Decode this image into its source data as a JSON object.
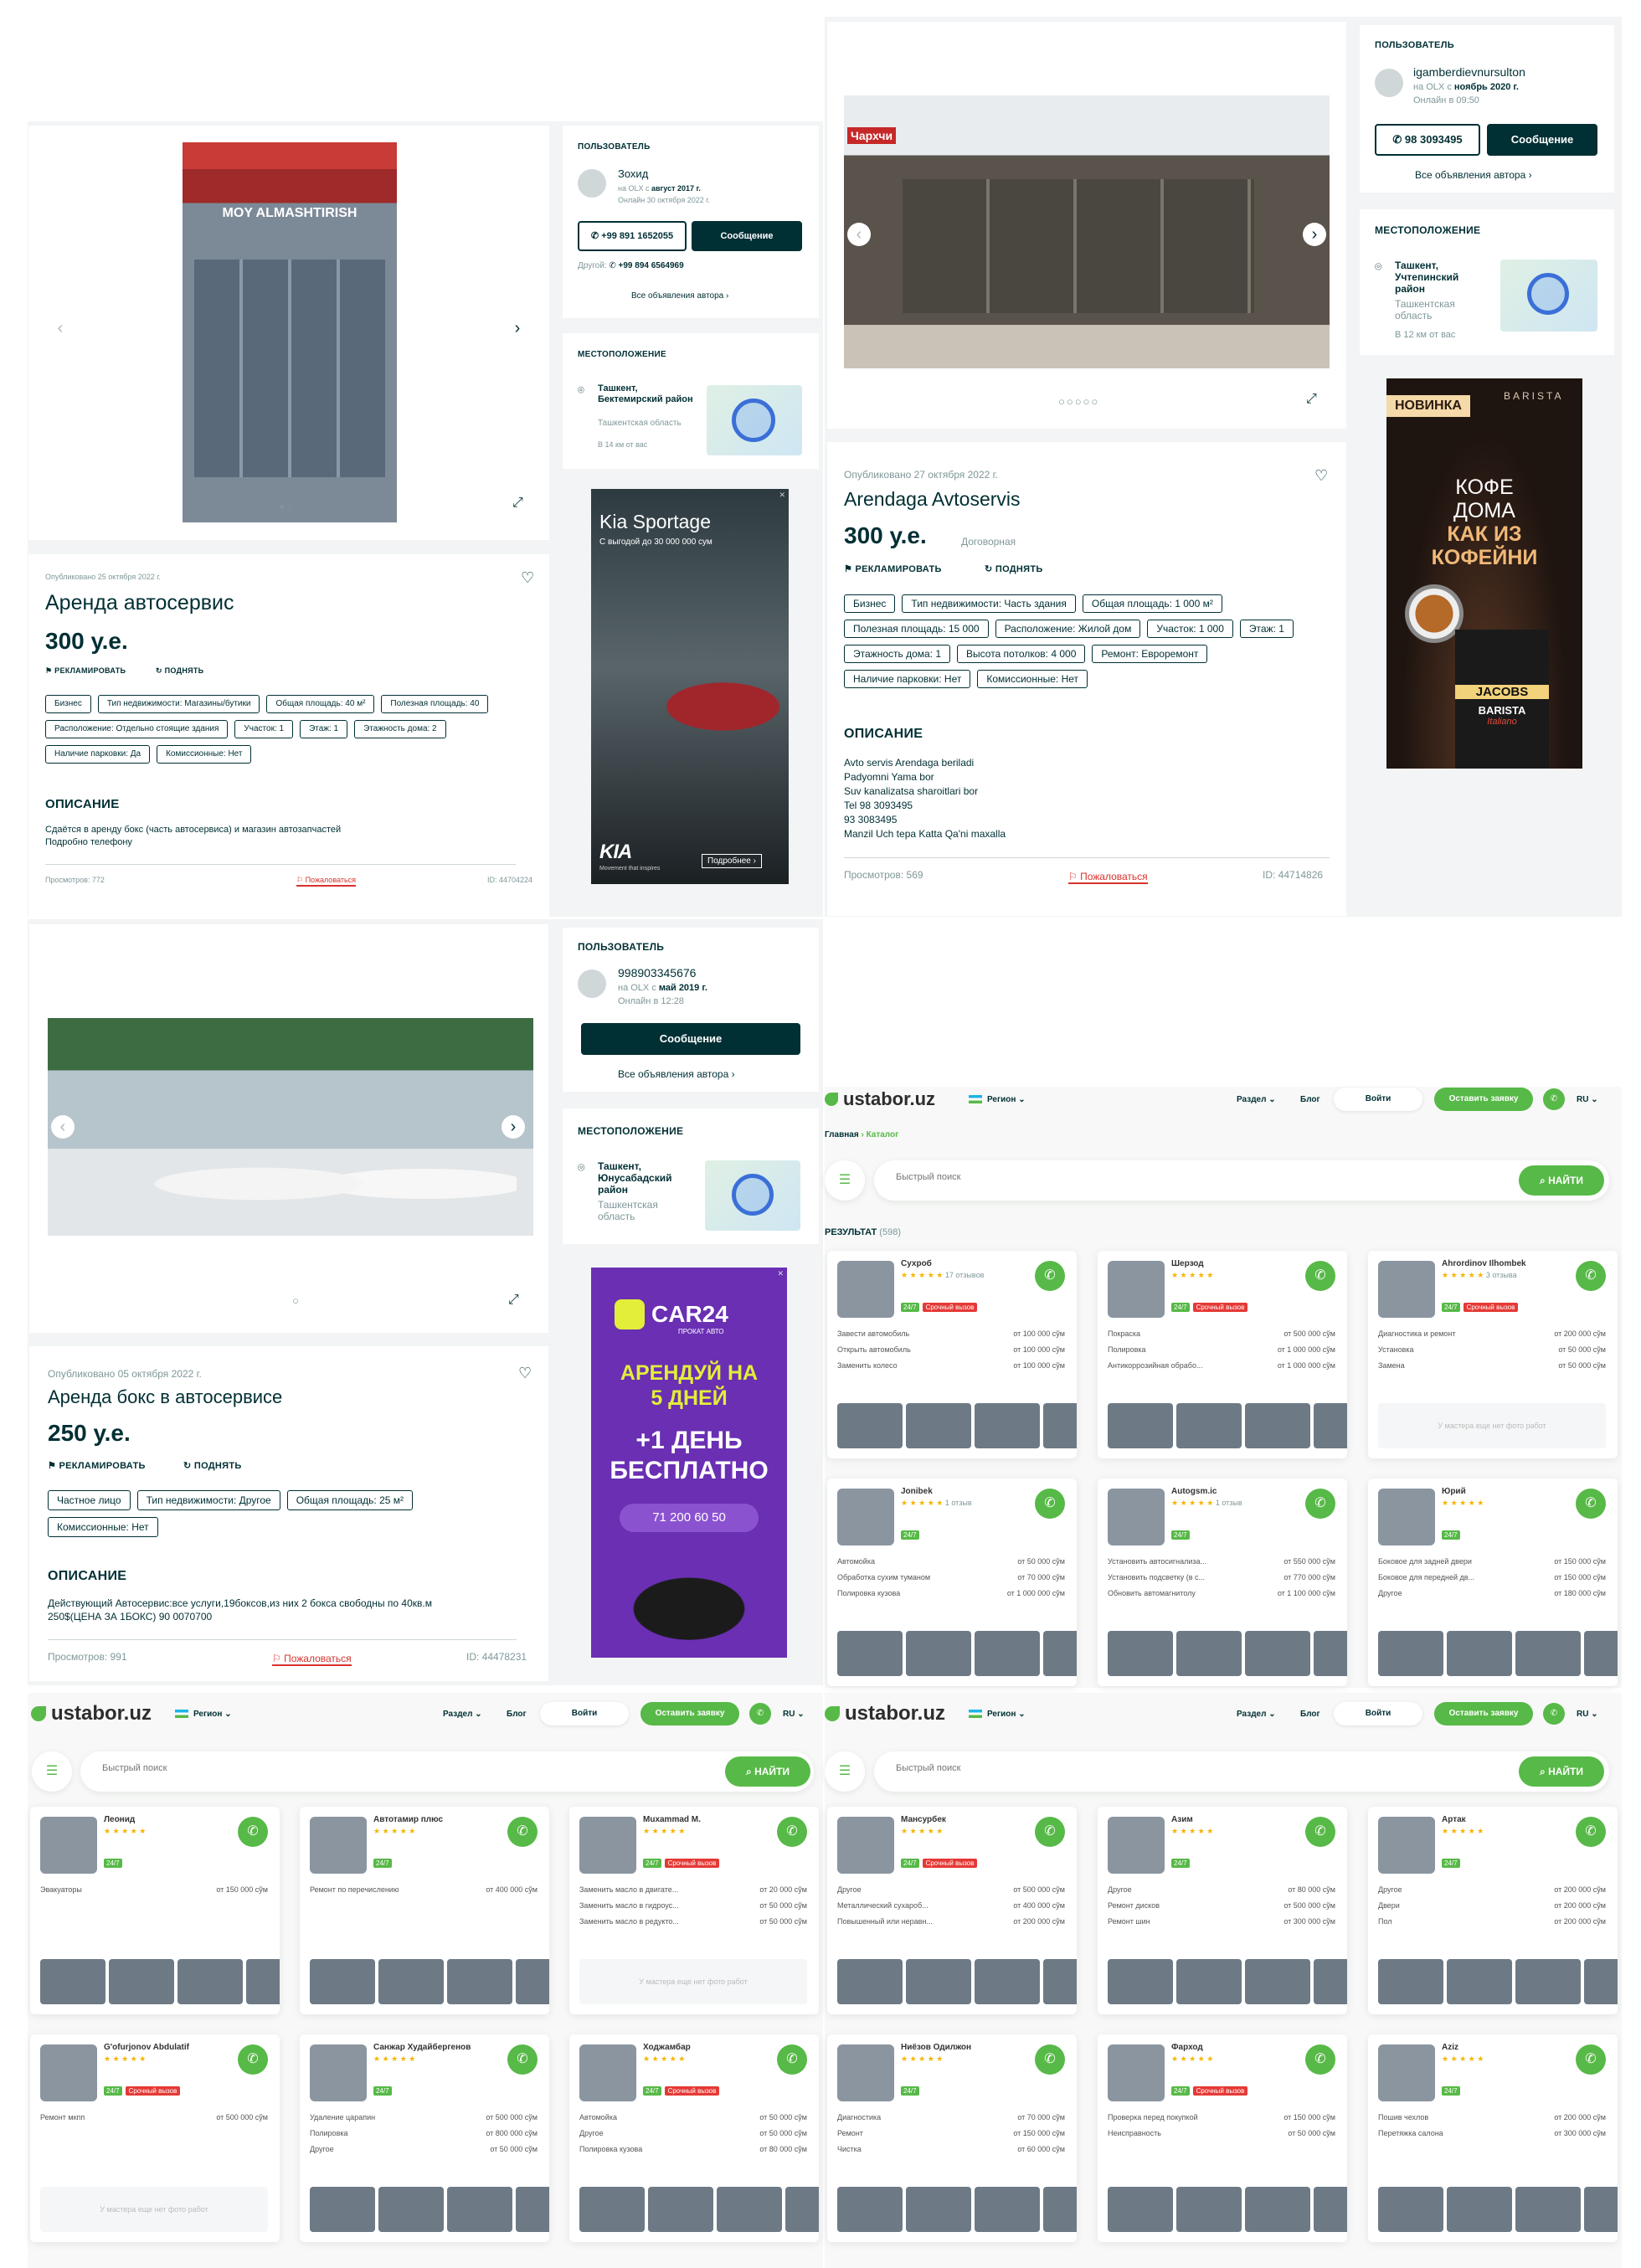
{
  "listing1": {
    "posted": "Опубликовано 25 октября 2022 г.",
    "title": "Аренда автосервис",
    "price": "300 у.е.",
    "promote": "РЕКЛАМИРОВАТЬ",
    "raise": "ПОДНЯТЬ",
    "tags": [
      "Бизнес",
      "Тип недвижимости: Магазины/бутики",
      "Общая площадь: 40 м²",
      "Полезная площадь: 40",
      "Расположение: Отдельно стоящие здания",
      "Участок: 1",
      "Этаж: 1",
      "Этажность дома: 2",
      "Наличие парковки: Да",
      "Комиссионные: Нет"
    ],
    "desc_heading": "ОПИСАНИЕ",
    "desc": [
      "Сдаётся в аренду бокс (часть автосервиса) и магазин автозапчастей",
      "Подробно телефону"
    ],
    "views": "Просмотров: 772",
    "report": "Пожаловаться",
    "id": "ID: 44704224",
    "image_sign": "MOY ALMASHTIRISH",
    "user": {
      "section": "ПОЛЬЗОВАТЕЛЬ",
      "name": "Зохид",
      "since_prefix": "на OLX с",
      "since": "август 2017 г.",
      "online": "Онлайн 30 октября 2022 г.",
      "phone": "+99 891 1652055",
      "message": "Сообщение",
      "other_label": "Другой:",
      "other_phone": "+99 894 6564969",
      "all_ads": "Все объявления автора"
    },
    "location": {
      "section": "МЕСТОПОЛОЖЕНИЕ",
      "city": "Ташкент, Бектемирский район",
      "region": "Ташкентская область",
      "distance": "В 14 км от вас"
    },
    "ad": {
      "title": "Kia Sportage",
      "subtitle": "С выгодой до 30 000 000 сум",
      "tagline": "Movement that inspires",
      "more": "Подробнее"
    }
  },
  "listing2": {
    "posted": "Опубликовано 27 октября 2022 г.",
    "title": "Arendaga Avtoservis",
    "price": "300 у.е.",
    "negotiable": "Договорная",
    "promote": "РЕКЛАМИРОВАТЬ",
    "raise": "ПОДНЯТЬ",
    "tags": [
      "Бизнес",
      "Тип недвижимости: Часть здания",
      "Общая площадь: 1 000 м²",
      "Полезная площадь: 15 000",
      "Расположение: Жилой дом",
      "Участок: 1 000",
      "Этаж: 1",
      "Этажность дома: 1",
      "Высота потолков: 4 000",
      "Ремонт: Евроремонт",
      "Наличие парковки: Нет",
      "Комиссионные: Нет"
    ],
    "desc_heading": "ОПИСАНИЕ",
    "desc": [
      "Avto servis Arendaga beriladi",
      "Padyomni Yama bor",
      "Suv kanalizatsa sharoitlari bor",
      "Tel 98 3093495",
      "93 3083495",
      "Manzil Uch tepa Katta Qa'ni maxalla"
    ],
    "views": "Просмотров: 569",
    "report": "Пожаловаться",
    "id": "ID: 44714826",
    "image_sign": "Чархчи",
    "user": {
      "section": "ПОЛЬЗОВАТЕЛЬ",
      "name": "igamberdievnursulton",
      "since_prefix": "на OLX с",
      "since": "ноябрь 2020 г.",
      "online": "Онлайн в 09:50",
      "phone": "98 3093495",
      "message": "Сообщение",
      "all_ads": "Все объявления автора"
    },
    "location": {
      "section": "МЕСТОПОЛОЖЕНИЕ",
      "city": "Ташкент, Учтепинский район",
      "region": "Ташкентская область",
      "distance": "В 12 км от вас"
    },
    "ad": {
      "badge": "НОВИНКА",
      "brand_top": "BARISTA",
      "line1": "КОФЕ",
      "line2": "ДОМА",
      "line3": "КАК ИЗ",
      "line4": "КОФЕЙНИ",
      "pack1": "JACOBS",
      "pack2": "BARISTA",
      "pack3": "Italiano"
    }
  },
  "listing3": {
    "posted": "Опубликовано 05 октября 2022 г.",
    "title": "Аренда бокс в автосервисе",
    "price": "250 у.е.",
    "promote": "РЕКЛАМИРОВАТЬ",
    "raise": "ПОДНЯТЬ",
    "tags": [
      "Частное лицо",
      "Тип недвижимости: Другое",
      "Общая площадь: 25 м²",
      "Комиссионные: Нет"
    ],
    "desc_heading": "ОПИСАНИЕ",
    "desc": [
      "Действующий Автосервис:все услуги,19боксов,из них 2 бокса свободны по 40кв.м",
      "250$(ЦЕНА ЗА 1БОКС) 90 0070700"
    ],
    "views": "Просмотров: 991",
    "report": "Пожаловаться",
    "id": "ID: 44478231",
    "user": {
      "section": "ПОЛЬЗОВАТЕЛЬ",
      "name": "998903345676",
      "since_prefix": "на OLX с",
      "since": "май 2019 г.",
      "online": "Онлайн в 12:28",
      "message": "Сообщение",
      "all_ads": "Все объявления автора"
    },
    "location": {
      "section": "МЕСТОПОЛОЖЕНИЕ",
      "city": "Ташкент, Юнусабадский район",
      "region": "Ташкентская область"
    },
    "ad": {
      "brand": "CAR24",
      "brand_sub": "ПРОКАТ АВТО",
      "line1": "АРЕНДУЙ НА",
      "line2": "5 ДНЕЙ",
      "line3": "+1 ДЕНЬ",
      "line4": "БЕСПЛАТНО",
      "phone": "71 200 60 50"
    }
  },
  "ustabor": {
    "logo": "ustabor.uz",
    "region": "Регион",
    "section": "Раздел",
    "blog": "Блог",
    "login": "Войти",
    "leave_request": "Оставить заявку",
    "lang": "RU",
    "breadcrumb_home": "Главная",
    "breadcrumb_catalog": "Каталог",
    "search_placeholder": "Быстрый поиск",
    "find": "НАЙТИ",
    "results": "РЕЗУЛЬТАТ",
    "results_count": "(598)",
    "no_photos": "У мастера еще нет фото работ",
    "badge_247": "24/7",
    "badge_urgent": "Срочный вызов",
    "accent": "#57b947"
  },
  "masters_a": [
    {
      "name": "Сухроб",
      "reviews": "17 отзывов",
      "urgent": true,
      "services": [
        [
          "Завести автомобиль",
          "от 100 000 сўм"
        ],
        [
          "Открыть автомобиль",
          "от 100 000 сўм"
        ],
        [
          "Заменить колесо",
          "от 100 000 сўм"
        ]
      ],
      "photos": true
    },
    {
      "name": "Шерзод",
      "urgent": true,
      "services": [
        [
          "Покраска",
          "от 500 000 сўм"
        ],
        [
          "Полировка",
          "от 1 000 000 сўм"
        ],
        [
          "Антикоррозийная обрабо...",
          "от 1 000 000 сўм"
        ]
      ],
      "photos": true
    },
    {
      "name": "Ahrordinov Ilhombek",
      "reviews": "3 отзыва",
      "urgent": true,
      "services": [
        [
          "Диагностика и ремонт",
          "от 200 000 сўм"
        ],
        [
          "Установка",
          "от 50 000 сўм"
        ],
        [
          "Замена",
          "от 50 000 сўм"
        ]
      ],
      "photos": false
    },
    {
      "name": "Jonibek",
      "reviews": "1 отзыв",
      "urgent": false,
      "services": [
        [
          "Автомойка",
          "от 50 000 сўм"
        ],
        [
          "Обработка сухим туманом",
          "от 70 000 сўм"
        ],
        [
          "Полировка кузова",
          "от 1 000 000 сўм"
        ]
      ],
      "photos": true
    },
    {
      "name": "Autogsm.ic",
      "reviews": "1 отзыв",
      "urgent": false,
      "services": [
        [
          "Установить автосигнализа...",
          "от 550 000 сўм"
        ],
        [
          "Установить подсветку (в с...",
          "от 770 000 сўм"
        ],
        [
          "Обновить автомагнитолу",
          "от 1 100 000 сўм"
        ]
      ],
      "photos": true
    },
    {
      "name": "Юрий",
      "urgent": false,
      "services": [
        [
          "Боковое для задней двери",
          "от 150 000 сўм"
        ],
        [
          "Боковое для передней дв...",
          "от 150 000 сўм"
        ],
        [
          "Другое",
          "от 180 000 сўм"
        ]
      ],
      "photos": true
    }
  ],
  "masters_b": [
    {
      "name": "Леонид",
      "urgent": false,
      "services": [
        [
          "Эвакуаторы",
          "от 150 000 сўм"
        ]
      ],
      "photos": true
    },
    {
      "name": "Автотамир плюс",
      "urgent": false,
      "services": [
        [
          "Ремонт по перечислению",
          "от 400 000 сўм"
        ]
      ],
      "photos": true
    },
    {
      "name": "Muxammad M.",
      "urgent": true,
      "services": [
        [
          "Заменить масло в двигате...",
          "от 20 000 сўм"
        ],
        [
          "Заменить масло в гидроус...",
          "от 50 000 сўм"
        ],
        [
          "Заменить масло в редукто...",
          "от 50 000 сўм"
        ]
      ],
      "photos": false
    },
    {
      "name": "G'ofurjonov Abdulatif",
      "urgent": true,
      "services": [
        [
          "Ремонт мкпп",
          "от 500 000 сўм"
        ]
      ],
      "photos": false
    },
    {
      "name": "Санжар Худайбергенов",
      "urgent": false,
      "services": [
        [
          "Удаление царапин",
          "от 500 000 сўм"
        ],
        [
          "Полировка",
          "от 800 000 сўм"
        ],
        [
          "Другое",
          "от 50 000 сўм"
        ]
      ],
      "photos": true
    },
    {
      "name": "Ходжамбар",
      "urgent": true,
      "services": [
        [
          "Автомойка",
          "от 50 000 сўм"
        ],
        [
          "Другое",
          "от 50 000 сўм"
        ],
        [
          "Полировка кузова",
          "от 80 000 сўм"
        ]
      ],
      "photos": true
    }
  ],
  "masters_c": [
    {
      "name": "Мансурбек",
      "urgent": true,
      "services": [
        [
          "Другое",
          "от 500 000 сўм"
        ],
        [
          "Металлический сухароб...",
          "от 400 000 сўм"
        ],
        [
          "Повышенный или неравн...",
          "от 200 000 сўм"
        ]
      ],
      "photos": true
    },
    {
      "name": "Азим",
      "urgent": false,
      "services": [
        [
          "Другое",
          "от 80 000 сўм"
        ],
        [
          "Ремонт дисков",
          "от 500 000 сўм"
        ],
        [
          "Ремонт шин",
          "от 300 000 сўм"
        ]
      ],
      "photos": true
    },
    {
      "name": "Артак",
      "urgent": false,
      "services": [
        [
          "Другое",
          "от 200 000 сўм"
        ],
        [
          "Двери",
          "от 200 000 сўм"
        ],
        [
          "Пол",
          "от 200 000 сўм"
        ]
      ],
      "photos": true
    },
    {
      "name": "Ниёзов Одилжон",
      "urgent": false,
      "services": [
        [
          "Диагностика",
          "от 70 000 сўм"
        ],
        [
          "Ремонт",
          "от 150 000 сўм"
        ],
        [
          "Чистка",
          "от 60 000 сўм"
        ]
      ],
      "photos": true
    },
    {
      "name": "Фарход",
      "urgent": true,
      "services": [
        [
          "Проверка перед покупкой",
          "от 150 000 сўм"
        ],
        [
          "Неисправность",
          "от 50 000 сўм"
        ]
      ],
      "photos": true
    },
    {
      "name": "Aziz",
      "urgent": false,
      "services": [
        [
          "Пошив чехлов",
          "от 200 000 сўм"
        ],
        [
          "Перетяжка салона",
          "от 300 000 сўм"
        ]
      ],
      "photos": true
    }
  ]
}
